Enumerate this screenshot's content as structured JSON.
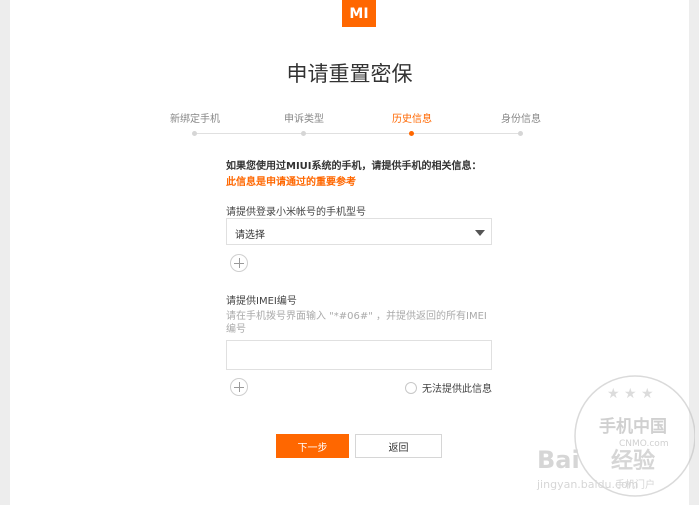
{
  "logo": {
    "text": "MI",
    "color": "#ff6700"
  },
  "title": "申请重置密保",
  "steps": [
    {
      "label": "新绑定手机",
      "active": false
    },
    {
      "label": "申诉类型",
      "active": false
    },
    {
      "label": "历史信息",
      "active": true
    },
    {
      "label": "身份信息",
      "active": false
    }
  ],
  "intro": {
    "text": "如果您使用过MIUI系统的手机，请提供手机的相关信息：",
    "note": "此信息是申请通过的重要参考"
  },
  "phone_model": {
    "label": "请提供登录小米帐号的手机型号",
    "select_value": "请选择"
  },
  "imei": {
    "label": "请提供IMEI编号",
    "hint": "请在手机拨号界面输入 \"*#06#\" ，并提供返回的所有IMEI编号",
    "value": "",
    "no_info_label": "无法提供此信息"
  },
  "buttons": {
    "next": "下一步",
    "back": "返回"
  },
  "watermark": {
    "line1": "手机中国",
    "line2": "CNMO.com",
    "line3": "Bai",
    "line4": "经验",
    "line5": "jingyan.baidu.com",
    "line6": "手机门户"
  },
  "colors": {
    "accent": "#ff6700",
    "border": "#e0e0e0"
  }
}
